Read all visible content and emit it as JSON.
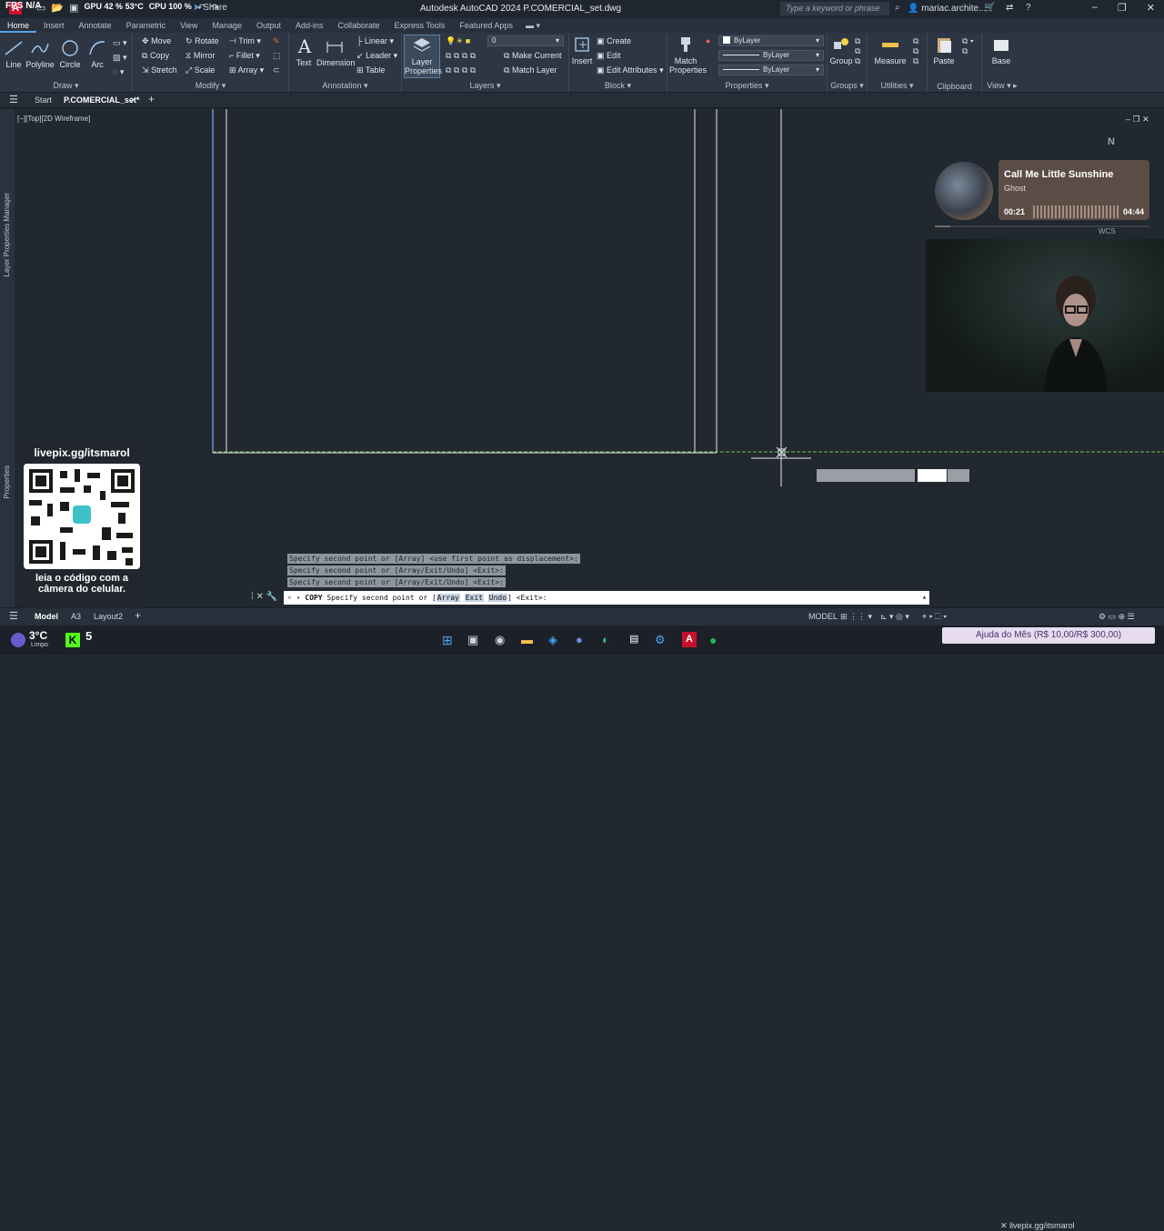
{
  "titlebar": {
    "stats": {
      "fps_label": "FPS",
      "fps_value": "N/A",
      "gpu_label": "GPU",
      "gpu_value": "42 %",
      "gpu_temp": "53°C",
      "cpu_label": "CPU",
      "cpu_value": "100 %"
    },
    "app_letter": "A",
    "share": "Share",
    "title": "Autodesk AutoCAD 2024    P.COMERCIAL_set.dwg",
    "search_placeholder": "Type a keyword or phrase",
    "user": "mariac.archite...",
    "window_controls": [
      "–",
      "❐",
      "✕"
    ]
  },
  "ribbon_tabs": [
    "Home",
    "Insert",
    "Annotate",
    "Parametric",
    "View",
    "Manage",
    "Output",
    "Add-ins",
    "Collaborate",
    "Express Tools",
    "Featured Apps"
  ],
  "ribbon": {
    "draw": {
      "title": "Draw",
      "buttons": [
        "Line",
        "Polyline",
        "Circle",
        "Arc"
      ]
    },
    "modify": {
      "title": "Modify",
      "rows": [
        [
          "Move",
          "Rotate",
          "Trim"
        ],
        [
          "Copy",
          "Mirror",
          "Fillet"
        ],
        [
          "Stretch",
          "Scale",
          "Array"
        ]
      ]
    },
    "annotation": {
      "title": "Annotation",
      "buttons": [
        "Text",
        "Dimension"
      ],
      "rows": [
        "Linear",
        "Leader",
        "Table"
      ]
    },
    "layers": {
      "title": "Layers",
      "big": "Layer Properties",
      "current_layer": "0",
      "rows": [
        "Make Current",
        "Match Layer"
      ]
    },
    "block": {
      "title": "Block",
      "big": "Insert",
      "rows": [
        "Create",
        "Edit",
        "Edit Attributes"
      ]
    },
    "properties": {
      "title": "Properties",
      "big": "Match Properties",
      "color": "ByLayer",
      "linetype": "ByLayer",
      "lineweight": "ByLayer"
    },
    "groups": {
      "title": "Groups",
      "big": "Group"
    },
    "utilities": {
      "title": "Utilities",
      "big": "Measure"
    },
    "clipboard": {
      "title": "Clipboard",
      "big": "Paste"
    },
    "view": {
      "title": "View",
      "big": "Base"
    }
  },
  "doc_tabs": {
    "start": "Start",
    "active": "P.COMERCIAL_set*",
    "close": "✕",
    "add": "+"
  },
  "viewport_label": "[−][Top][2D Wireframe]",
  "side_palettes": [
    "Layer Properties Manager",
    "Properties"
  ],
  "command": {
    "history": [
      "Specify second point or [Array] <use first point as displacement>:",
      "Specify second point or [Array/Exit/Undo] <Exit>:",
      "Specify second point or [Array/Exit/Undo] <Exit>:"
    ],
    "prompt_cmd": "COPY",
    "prompt_text": "Specify second point or [",
    "options": [
      "Array",
      "Exit",
      "Undo"
    ],
    "prompt_end": "] <Exit>:"
  },
  "layout_tabs": [
    "Model",
    "A3",
    "Layout2"
  ],
  "status": {
    "model_label": "MODEL"
  },
  "overlay": {
    "pix_url": "livepix.gg/itsmarol",
    "pix_msg": "leia o código com a câmera do celular.",
    "song": "Call Me Little Sunshine",
    "artist": "Ghost",
    "time_current": "00:21",
    "time_total": "04:44",
    "progress": 0.074,
    "goal_text": "Ajuda do Mês (R$ 10,00/R$ 300,00)",
    "goal_user": "livepix.gg/itsmarol",
    "compass_n": "N",
    "wcs": "WCS"
  },
  "taskbar": {
    "weather_temp": "3°C",
    "weather_desc": "Limpo",
    "kick_count": "5"
  },
  "colors": {
    "accent": "#5c9ee6",
    "canvas": "#212830",
    "ribbon": "#2d3642",
    "green_line": "#6fbf4a",
    "app_red": "#c8102e"
  }
}
